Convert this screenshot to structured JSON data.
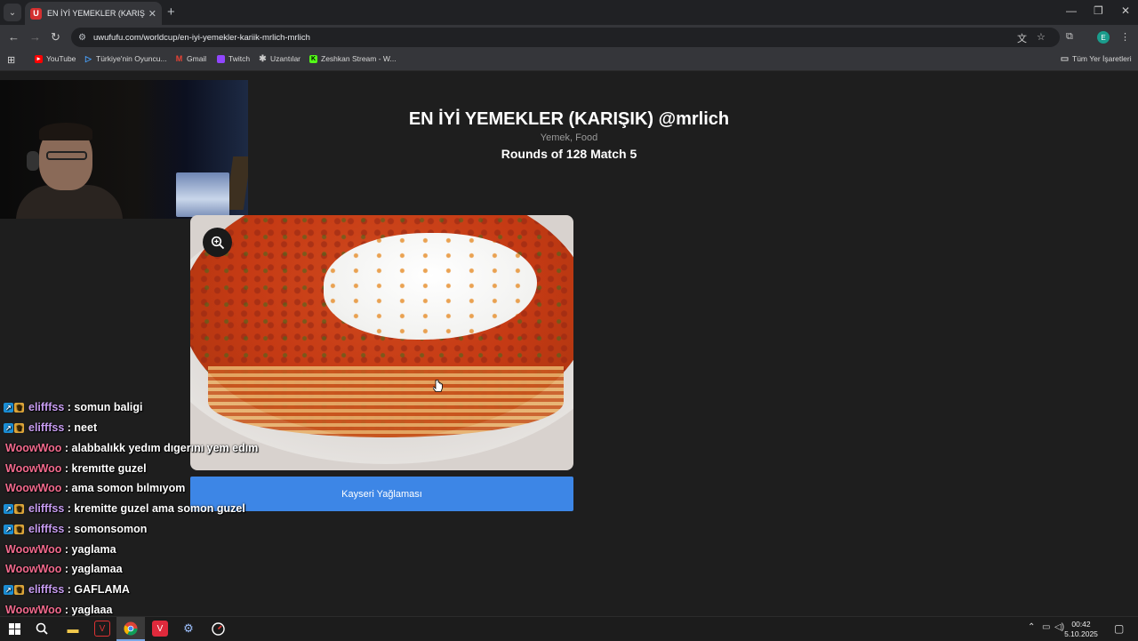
{
  "browser": {
    "tab": {
      "favicon_letter": "U",
      "title": "EN İYİ YEMEKLER (KARIŞIK) @m"
    },
    "url": "uwufufu.com/worldcup/en-iyi-yemekler-kariik-mrlich-mrlich",
    "profile_initial": "E",
    "bookmarks": [
      {
        "label": "YouTube",
        "icon": "youtube-icon",
        "color": "#ff0000"
      },
      {
        "label": "Türkiye'nin Oyuncu...",
        "icon": "play-icon",
        "color": "#4aa3ff"
      },
      {
        "label": "Gmail",
        "icon": "gmail-icon",
        "color": "#ea4335"
      },
      {
        "label": "Twitch",
        "icon": "twitch-icon",
        "color": "#9146ff"
      },
      {
        "label": "Uzantılar",
        "icon": "puzzle-icon",
        "color": "#cccccc"
      },
      {
        "label": "Zeshkan Stream - W...",
        "icon": "kick-icon",
        "color": "#53fc18"
      }
    ],
    "all_bookmarks": "Tüm Yer İşaretleri"
  },
  "page": {
    "title": "EN İYİ YEMEKLER (KARIŞIK) @mrlich",
    "subtitle": "Yemek, Food",
    "round": "Rounds of 128 Match 5",
    "choice_label": "Kayseri Yağlaması"
  },
  "chat": [
    {
      "user": "elifffss",
      "text": ": somun baligi",
      "badges": true
    },
    {
      "user": "elifffss",
      "text": ": neet",
      "badges": true
    },
    {
      "user": "WoowWoo",
      "text": ": alabbalıkk yedım dıgerını yem edım",
      "badges": false
    },
    {
      "user": "WoowWoo",
      "text": ": kremıtte guzel",
      "badges": false
    },
    {
      "user": "WoowWoo",
      "text": ": ama somon bılmıyom",
      "badges": false
    },
    {
      "user": "elifffss",
      "text": ": kremitte guzel ama somon guzel",
      "badges": true
    },
    {
      "user": "elifffss",
      "text": ": somonsomon",
      "badges": true
    },
    {
      "user": "WoowWoo",
      "text": ": yaglama",
      "badges": false
    },
    {
      "user": "WoowWoo",
      "text": ": yaglamaa",
      "badges": false
    },
    {
      "user": "elifffss",
      "text": ": GAFLAMA",
      "badges": true
    },
    {
      "user": "WoowWoo",
      "text": ": yaglaaa",
      "badges": false
    }
  ],
  "taskbar": {
    "time": "00:42",
    "date": "5.10.2025"
  },
  "colors": {
    "accent_button": "#3d86e6",
    "user_elifffss": "#c79cf0",
    "user_woowwoo": "#f26a8d"
  }
}
